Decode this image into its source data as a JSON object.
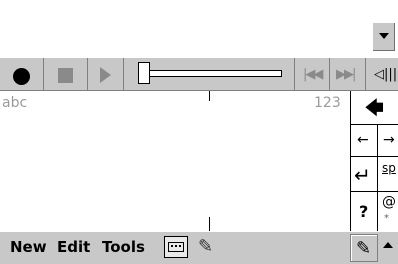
{
  "toolbar": {
    "record_icon": "record-icon",
    "stop_icon": "stop-icon",
    "play_icon": "play-icon",
    "position_fraction": 0.0,
    "prev_glyph": "|◀◀",
    "next_glyph": "▶▶|",
    "volume_glyph": "◁|||"
  },
  "writing": {
    "left_mode_label": "abc",
    "right_mode_label": "123"
  },
  "keypad": {
    "backspace": "🡄",
    "left_arrow": "←",
    "right_arrow": "→",
    "enter": "↵",
    "space": "sp",
    "question": "?",
    "at": "@",
    "star": "*"
  },
  "menubar": {
    "new": "New",
    "edit": "Edit",
    "tools": "Tools",
    "pen_glyph": "✎"
  },
  "colors": {
    "chrome": "#c8c8c8",
    "mode_label": "#9a9a9a",
    "disabled_icon": "#8a8a8a"
  }
}
